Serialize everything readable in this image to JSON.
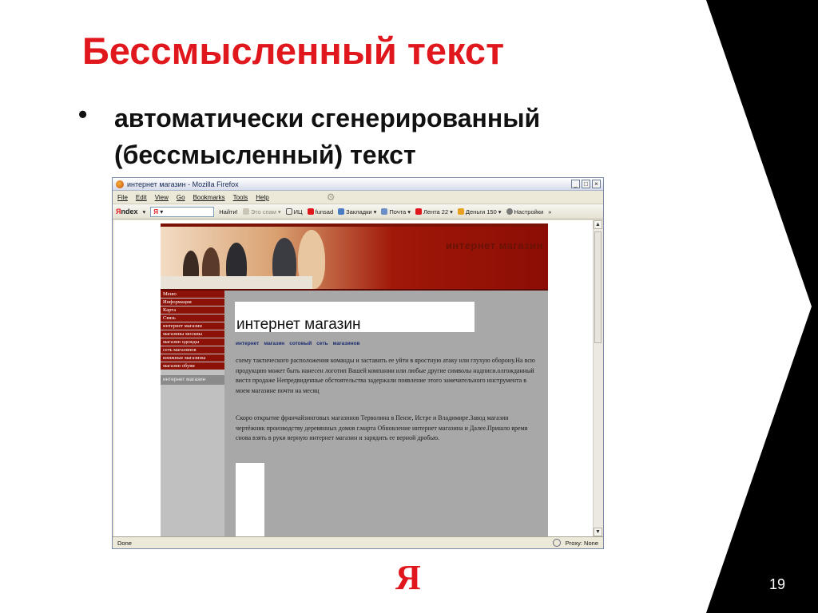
{
  "slide": {
    "title": "Бессмысленный текст",
    "bullet_marker": "•",
    "bullet_text": "автоматически сгенерированный (бессмысленный) текст",
    "logo": "Я",
    "page_number": "19",
    "accent_color": "#e0171c"
  },
  "browser": {
    "window_title": "интернет магазин - Mozilla Firefox",
    "window_buttons": [
      "_",
      "□",
      "×"
    ],
    "menu": [
      "File",
      "Edit",
      "View",
      "Go",
      "Bookmarks",
      "Tools",
      "Help"
    ],
    "toolbar": {
      "yandex_label": "ndex",
      "yandex_letter": "Я",
      "search_value": "Я",
      "find_button": "Найти!",
      "spam_label": "Это спам",
      "ic_label": "ИЦ",
      "funsad_label": "funsad",
      "bookmarks_label": "Закладки",
      "mail_label": "Почта",
      "lenta_label": "Лента 22",
      "money_label": "Деньги 150",
      "settings_label": "Настройки",
      "more": "»"
    },
    "status": {
      "left": "Done",
      "proxy": "Proxy: None"
    }
  },
  "website": {
    "banner_text": "интернет магазин",
    "nav_items": [
      "Меню",
      "Информация",
      "Карта",
      "Связь",
      "интернет магазин",
      "магазины москвы",
      "магазин одежды",
      "сеть магазинов",
      "книжные магазины",
      "магазин обуви"
    ],
    "nav_caption": "интернет магазин",
    "logo_text": "интернет магазин",
    "subnav": [
      "интернет",
      "магазин",
      "сотовый",
      "сеть",
      "магазинов"
    ],
    "paragraph1": "схему тактического расположения команды и заставить ее уйти в яростную атаку или глухую оборону.На всю продукцию может быть нанесен логотип Вашей компании или любые другие символы надписи.олгожданный вистл продаже Непредвиденные обстоятельства задержали появление этого замечательного инструмента в моем магазине почти на месяц",
    "paragraph2": "Скоро открытие франчайзинговых магазинов Терволина в Пензе, Истре и Владимире.Завод магазин чертёжник производству деревянных домов г.марта Обновление интернет магазина и Далее.Пришло время снова взять в руки верную интернет магазин и зарядить ее верной дробью."
  }
}
